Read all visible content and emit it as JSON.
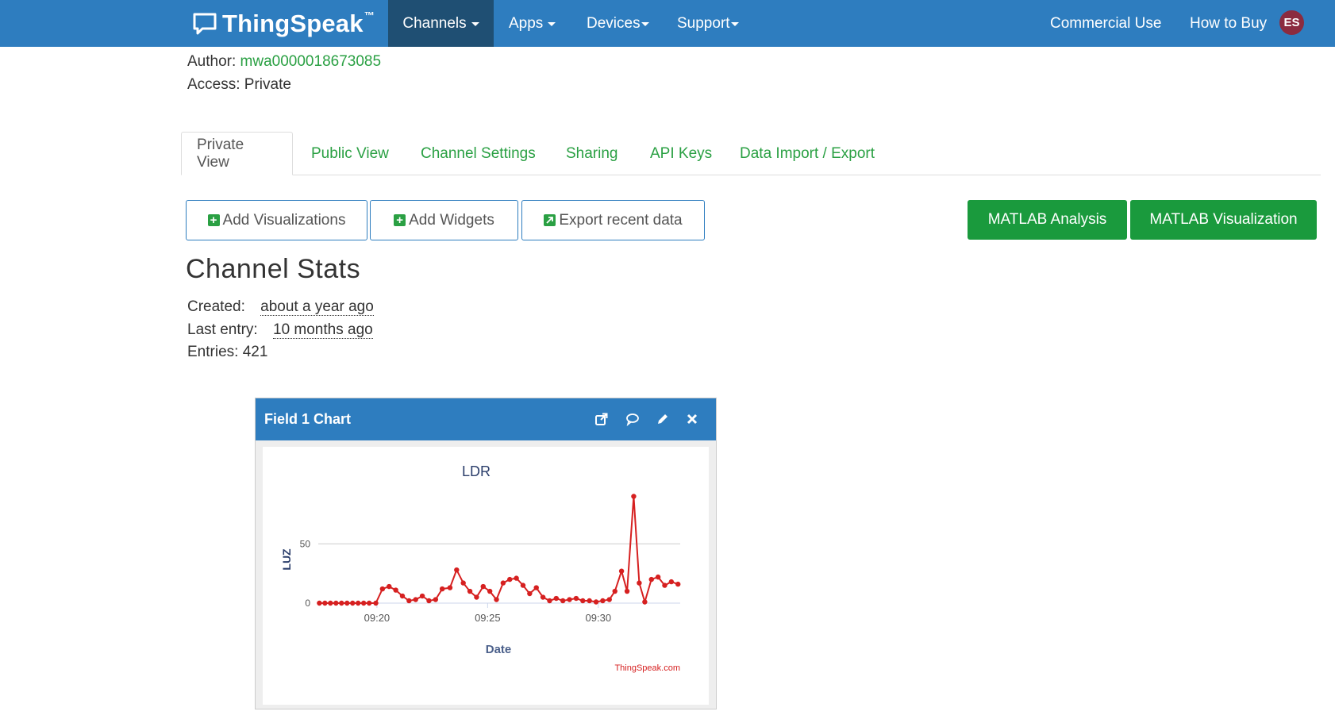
{
  "navbar": {
    "brand": "ThingSpeak",
    "brand_tm": "™",
    "menu": {
      "channels": "Channels",
      "apps": "Apps",
      "devices": "Devices",
      "support": "Support"
    },
    "right": {
      "commercial": "Commercial Use",
      "how_to_buy": "How to Buy",
      "avatar_initials": "ES"
    },
    "colors": {
      "bar": "#2e7dbf",
      "active": "#1f4f73",
      "avatar": "#8b2b3f"
    }
  },
  "channel_meta": {
    "author_label": "Author:",
    "author_value": "mwa0000018673085",
    "access": "Access: Private"
  },
  "tabs": {
    "private_view": "Private View",
    "public_view": "Public View",
    "channel_settings": "Channel Settings",
    "sharing": "Sharing",
    "api_keys": "API Keys",
    "data_import_export": "Data Import / Export"
  },
  "actions": {
    "add_visualizations": "Add Visualizations",
    "add_widgets": "Add Widgets",
    "export_recent_data": "Export recent data",
    "matlab_analysis": "MATLAB Analysis",
    "matlab_visualization": "MATLAB Visualization"
  },
  "stats": {
    "title": "Channel Stats",
    "created_label": "Created:",
    "created_value": "about a year ago",
    "last_entry_label": "Last entry:",
    "last_entry_value": "10 months ago",
    "entries": "Entries: 421"
  },
  "widget": {
    "title": "Field 1 Chart",
    "icons": [
      "external-link-icon",
      "comment-icon",
      "pencil-icon",
      "close-icon"
    ]
  },
  "chart_data": {
    "type": "line",
    "title": "LDR",
    "xlabel": "Date",
    "ylabel": "LUZ",
    "credit": "ThingSpeak.com",
    "x_tick_labels": [
      "09:20",
      "09:25",
      "09:30"
    ],
    "x_tick_minutes": [
      20,
      25,
      30
    ],
    "y_ticks": [
      0,
      50
    ],
    "xlim": [
      17.35,
      33.7
    ],
    "ylim": [
      0,
      95
    ],
    "grid": true,
    "legend": "none",
    "color": "#d62020",
    "series": [
      {
        "x": [
          17.4,
          17.65,
          17.9,
          18.15,
          18.4,
          18.65,
          18.9,
          19.15,
          19.4,
          19.65,
          19.95,
          20.25,
          20.55,
          20.85,
          21.15,
          21.45,
          21.75,
          22.05,
          22.35,
          22.65,
          22.95,
          23.3,
          23.6,
          23.9,
          24.2,
          24.5,
          24.8,
          25.1,
          25.4,
          25.7,
          26.0,
          26.3,
          26.6,
          26.9,
          27.2,
          27.5,
          27.8,
          28.1,
          28.4,
          28.7,
          29.0,
          29.3,
          29.6,
          29.9,
          30.2,
          30.5,
          30.75,
          31.05,
          31.3,
          31.6,
          31.85,
          32.1,
          32.4,
          32.7,
          33.0,
          33.3,
          33.6
        ],
        "y": [
          0,
          0,
          0,
          0,
          0,
          0,
          0,
          0,
          0,
          0,
          0,
          12,
          14,
          11,
          6,
          2,
          3,
          6,
          2,
          3,
          12,
          13,
          28,
          17,
          10,
          5,
          14,
          10,
          3,
          17,
          20,
          21,
          15,
          8,
          13,
          5,
          2,
          4,
          2,
          3,
          4,
          2,
          2,
          1,
          2,
          3,
          10,
          27,
          10,
          90,
          17,
          1,
          20,
          22,
          15,
          18,
          16
        ]
      }
    ]
  }
}
